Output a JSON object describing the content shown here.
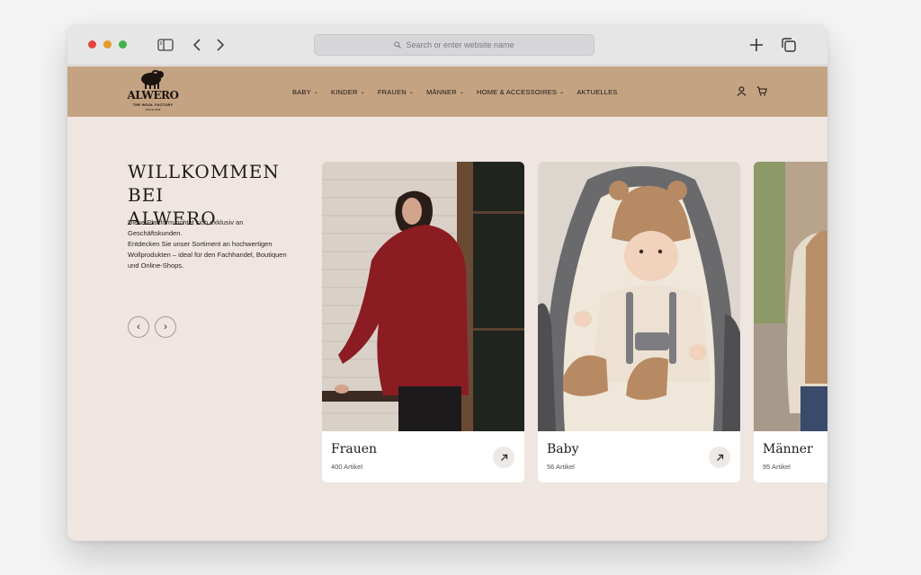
{
  "browser": {
    "url_placeholder": "Search or enter website name"
  },
  "site": {
    "logo": {
      "word": "ALWERO",
      "tagline": "THE WOOL FACTORY",
      "since": "SINCE 1999"
    },
    "menu": [
      {
        "label": "BABY",
        "dropdown": true
      },
      {
        "label": "KINDER",
        "dropdown": true
      },
      {
        "label": "FRAUEN",
        "dropdown": true
      },
      {
        "label": "MÄNNER",
        "dropdown": true
      },
      {
        "label": "HOME & ACCESSOIRES",
        "dropdown": true
      },
      {
        "label": "AKTUELLES",
        "dropdown": false
      }
    ],
    "icons": {
      "account": "user-icon",
      "cart": "cart-icon"
    },
    "brand_color": "#c4a382",
    "background_color": "#efe6e1"
  },
  "hero": {
    "title_line1": "WILLKOMMEN BEI",
    "title_line2": "ALWERO",
    "desc_line1": "Diese Plattform richtet sich exklusiv an",
    "desc_line2": "Geschäftskunden.",
    "desc_line3": "Entdecken Sie unser Sortiment an hochwertigen",
    "desc_line4": "Wollprodukten – ideal für den Fachhandel, Boutiquen",
    "desc_line5": "und Online-Shops."
  },
  "cards": [
    {
      "title": "Frauen",
      "count": "400 Artikel"
    },
    {
      "title": "Baby",
      "count": "56 Artikel"
    },
    {
      "title": "Männer",
      "count": "95 Artikel"
    }
  ]
}
